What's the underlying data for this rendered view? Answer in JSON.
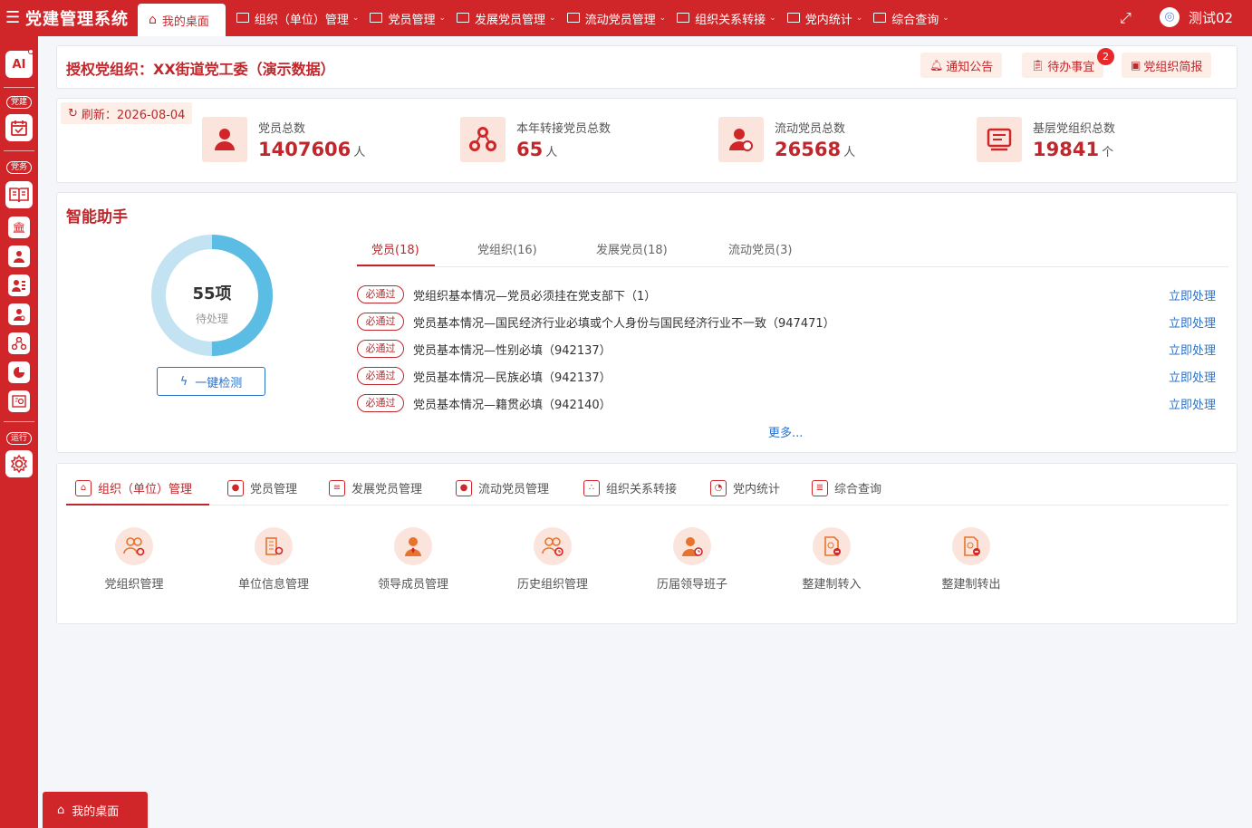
{
  "app": {
    "title": "党建管理系统"
  },
  "topbar": {
    "home_tab": "我的桌面",
    "menus": [
      {
        "label": "组织（单位）管理"
      },
      {
        "label": "党员管理"
      },
      {
        "label": "发展党员管理"
      },
      {
        "label": "流动党员管理"
      },
      {
        "label": "组织关系转接"
      },
      {
        "label": "党内统计"
      },
      {
        "label": "综合查询"
      }
    ],
    "user": "测试02"
  },
  "sidebar": {
    "ai_label": "AI",
    "groups": [
      "党建",
      "党务",
      "运行"
    ]
  },
  "header": {
    "auth_title": "授权党组织：XX街道党工委（演示数据）",
    "buttons": [
      "通知公告",
      "待办事宜",
      "党组织简报"
    ],
    "todo_badge": "2"
  },
  "stats": {
    "refresh": "刷新：2026-08-04",
    "items": [
      {
        "label": "党员总数",
        "value": "1407606",
        "unit": "人"
      },
      {
        "label": "本年转接党员总数",
        "value": "65",
        "unit": "人"
      },
      {
        "label": "流动党员总数",
        "value": "26568",
        "unit": "人"
      },
      {
        "label": "基层党组织总数",
        "value": "19841",
        "unit": "个"
      }
    ]
  },
  "assistant": {
    "title": "智能助手",
    "pending_count": "55项",
    "pending_label": "待处理",
    "pending_progress": 0.5,
    "check_button": "一键检测",
    "tabs": [
      "党员(18)",
      "党组织(16)",
      "发展党员(18)",
      "流动党员(3)"
    ],
    "active_tab": 0,
    "rows": [
      {
        "tag": "必通过",
        "text": "党组织基本情况—党员必须挂在党支部下（1）",
        "action": "立即处理"
      },
      {
        "tag": "必通过",
        "text": "党员基本情况—国民经济行业必填或个人身份与国民经济行业不一致（947471）",
        "action": "立即处理"
      },
      {
        "tag": "必通过",
        "text": "党员基本情况—性别必填（942137）",
        "action": "立即处理"
      },
      {
        "tag": "必通过",
        "text": "党员基本情况—民族必填（942137）",
        "action": "立即处理"
      },
      {
        "tag": "必通过",
        "text": "党员基本情况—籍贯必填（942140）",
        "action": "立即处理"
      }
    ],
    "more": "更多..."
  },
  "modules": {
    "tabs": [
      "组织（单位）管理",
      "党员管理",
      "发展党员管理",
      "流动党员管理",
      "组织关系转接",
      "党内统计",
      "综合查询"
    ],
    "active_tab": 0,
    "items": [
      "党组织管理",
      "单位信息管理",
      "领导成员管理",
      "历史组织管理",
      "历届领导班子",
      "整建制转入",
      "整建制转出"
    ]
  },
  "bottom_tab": "我的桌面",
  "colors": {
    "primary": "#d0262a",
    "accent_light": "#fbe4dc",
    "link": "#2b72c9",
    "donut_fill": "#5bbce4",
    "donut_track": "#c4e3f2"
  }
}
